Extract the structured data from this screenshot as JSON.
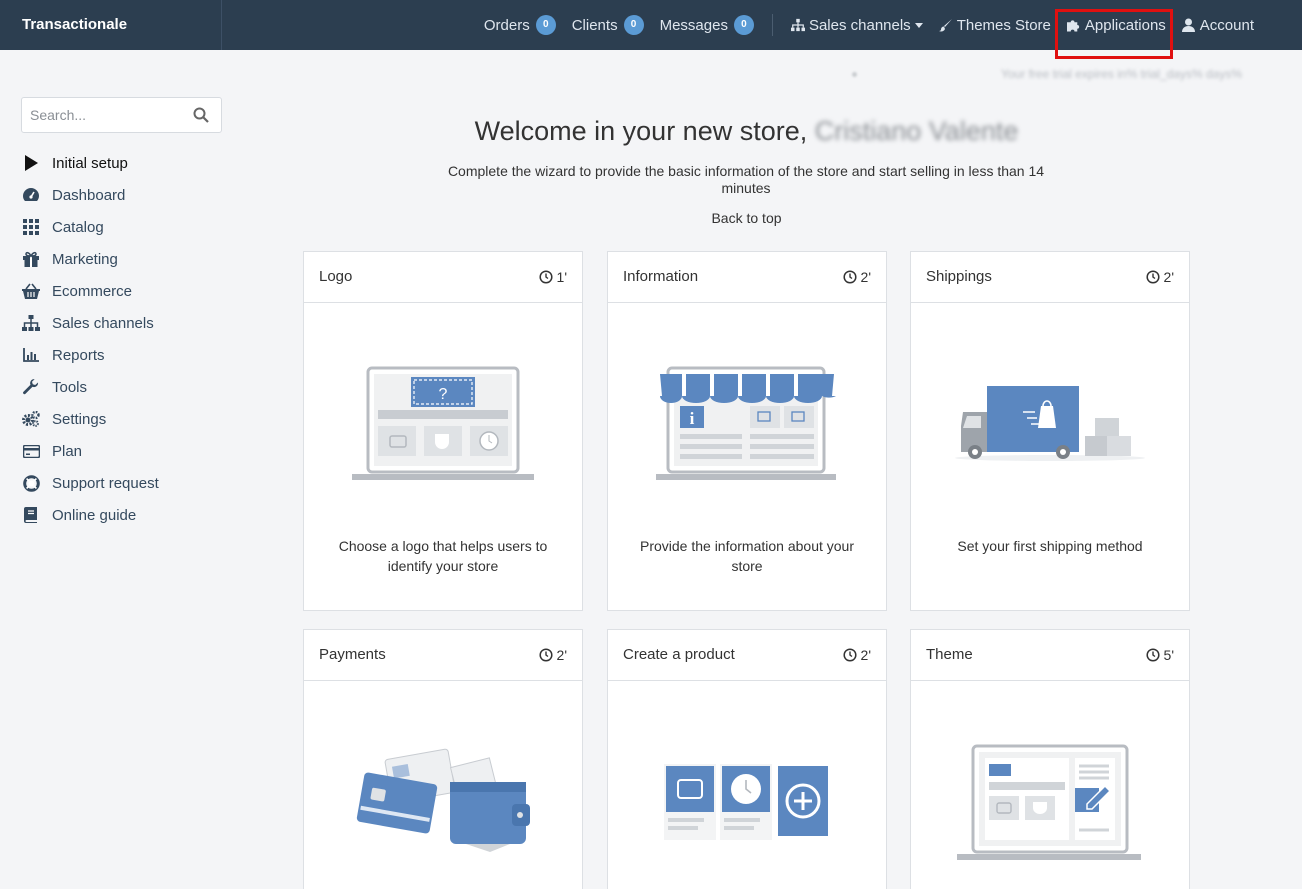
{
  "brand": "Transactionale",
  "topnav": {
    "orders": {
      "label": "Orders",
      "count": "0"
    },
    "clients": {
      "label": "Clients",
      "count": "0"
    },
    "messages": {
      "label": "Messages",
      "count": "0"
    },
    "sales_channels": "Sales channels",
    "themes_store": "Themes Store",
    "applications": "Applications",
    "account": "Account"
  },
  "trial_notice": "Your free trial expires in% trial_days% days%",
  "sidebar": {
    "search_placeholder": "Search...",
    "items": [
      {
        "label": "Initial setup",
        "icon": "play-icon"
      },
      {
        "label": "Dashboard",
        "icon": "dashboard-icon"
      },
      {
        "label": "Catalog",
        "icon": "grid-icon"
      },
      {
        "label": "Marketing",
        "icon": "gift-icon"
      },
      {
        "label": "Ecommerce",
        "icon": "basket-icon"
      },
      {
        "label": "Sales channels",
        "icon": "sitemap-icon"
      },
      {
        "label": "Reports",
        "icon": "bar-chart-icon"
      },
      {
        "label": "Tools",
        "icon": "wrench-icon"
      },
      {
        "label": "Settings",
        "icon": "gears-icon"
      },
      {
        "label": "Plan",
        "icon": "credit-card-icon"
      },
      {
        "label": "Support request",
        "icon": "lifebuoy-icon"
      },
      {
        "label": "Online guide",
        "icon": "book-icon"
      }
    ]
  },
  "main": {
    "welcome": "Welcome in your new store,",
    "user_name": "Cristiano Valente",
    "subtitle": "Complete the wizard to provide the basic information of the store and start selling in less than 14 minutes",
    "back_to_top": "Back to top",
    "cards": [
      {
        "title": "Logo",
        "time": "1'",
        "text": "Choose a logo that helps users to identify your store"
      },
      {
        "title": "Information",
        "time": "2'",
        "text": "Provide the information about your store"
      },
      {
        "title": "Shippings",
        "time": "2'",
        "text": "Set your first shipping method"
      },
      {
        "title": "Payments",
        "time": "2'",
        "text": ""
      },
      {
        "title": "Create a product",
        "time": "2'",
        "text": ""
      },
      {
        "title": "Theme",
        "time": "5'",
        "text": ""
      }
    ]
  },
  "colors": {
    "topbar": "#2c3e50",
    "accent": "#5b87c0",
    "badge": "#5b9bd5",
    "highlight": "#e01010"
  }
}
